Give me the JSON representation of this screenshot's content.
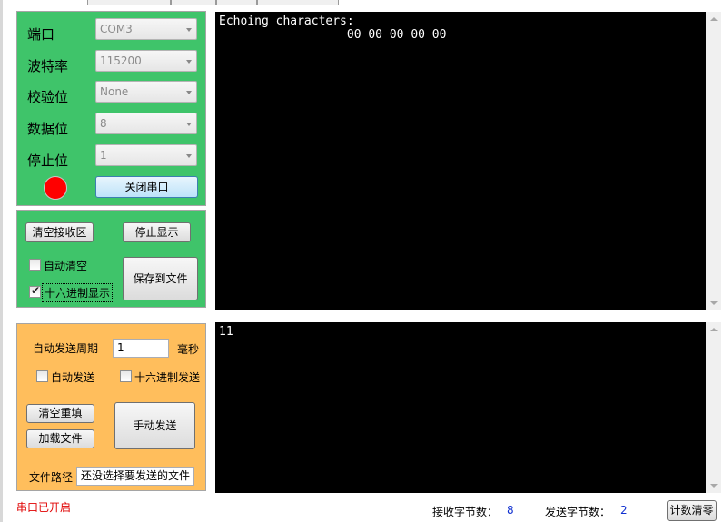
{
  "serial": {
    "port_label": "端口",
    "port_value": "COM3",
    "baud_label": "波特率",
    "baud_value": "115200",
    "parity_label": "校验位",
    "parity_value": "None",
    "databits_label": "数据位",
    "databits_value": "8",
    "stopbits_label": "停止位",
    "stopbits_value": "1",
    "toggle_label": "关闭串口",
    "status_color": "#ff0000"
  },
  "receive": {
    "clear_label": "清空接收区",
    "stop_label": "停止显示",
    "auto_clear_label": "自动清空",
    "auto_clear_checked": false,
    "hex_display_label": "十六进制显示",
    "hex_display_checked": true,
    "save_label": "保存到文件",
    "text": "Echoing characters:\n                  00 00 00 00 00"
  },
  "send": {
    "period_label": "自动发送周期",
    "period_value": "1",
    "period_unit": "毫秒",
    "auto_send_label": "自动发送",
    "auto_send_checked": false,
    "hex_send_label": "十六进制发送",
    "hex_send_checked": false,
    "clear_label": "清空重填",
    "load_label": "加载文件",
    "manual_label": "手动发送",
    "path_label": "文件路径",
    "path_value": "还没选择要发送的文件",
    "text": "11"
  },
  "status": {
    "port_state": "串口已开启",
    "rx_label": "接收字节数：",
    "rx_count": "8",
    "tx_label": "发送字节数：",
    "tx_count": "2",
    "reset_label": "计数清零"
  },
  "colors": {
    "serial_panel": "#3fc46a",
    "send_panel": "#ffbe5c",
    "terminal_bg": "#000000"
  }
}
